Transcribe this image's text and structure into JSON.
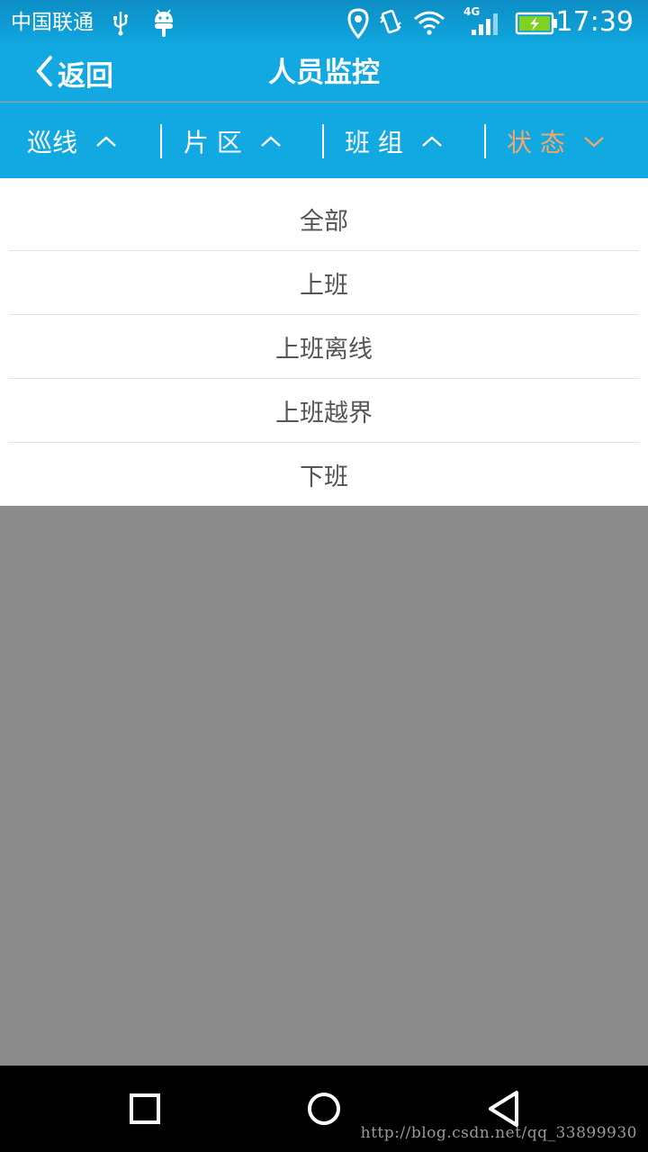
{
  "status_bar": {
    "carrier": "中国联通",
    "network": "4G",
    "time": "17:39",
    "icons": [
      "usb-icon",
      "android-icon",
      "location-icon",
      "vibrate-icon",
      "wifi-icon",
      "signal-icon",
      "battery-charging-icon"
    ]
  },
  "header": {
    "back_label": "返回",
    "title": "人员监控"
  },
  "filters": [
    {
      "label": "巡线",
      "state": "collapsed"
    },
    {
      "label": "片 区",
      "state": "collapsed"
    },
    {
      "label": "班 组",
      "state": "collapsed"
    },
    {
      "label": "状 态",
      "state": "expanded"
    }
  ],
  "status_options": [
    "全部",
    "上班",
    "上班离线",
    "上班越界",
    "下班"
  ],
  "nav": [
    "recents-button",
    "home-button",
    "back-button"
  ],
  "watermark": "http://blog.csdn.net/qq_33899930",
  "colors": {
    "primary": "#12a9e2",
    "active_filter": "#f0a76a",
    "overlay": "#8c8c8c"
  }
}
